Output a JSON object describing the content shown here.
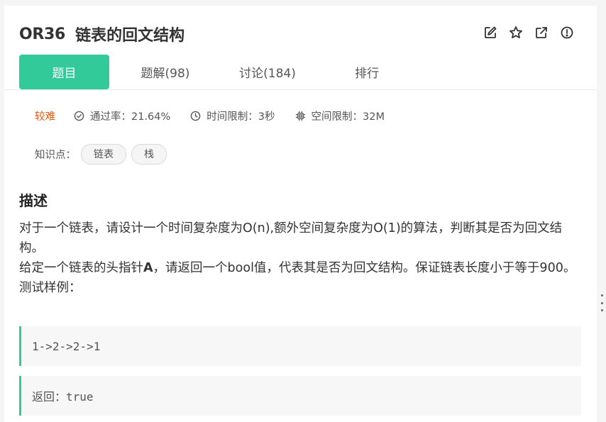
{
  "problem": {
    "id": "OR36",
    "title": "链表的回文结构"
  },
  "toolbar": {
    "icons": [
      "edit-icon",
      "star-icon",
      "share-icon",
      "report-icon"
    ]
  },
  "tabs": [
    {
      "label": "题目",
      "active": true
    },
    {
      "label": "题解(98)",
      "active": false
    },
    {
      "label": "讨论(184)",
      "active": false
    },
    {
      "label": "排行",
      "active": false
    }
  ],
  "meta": {
    "difficulty": "较难",
    "pass_rate": "通过率：21.64%",
    "time_limit": "时间限制：3秒",
    "space_limit": "空间限制：32M"
  },
  "knowledge": {
    "label": "知识点：",
    "tags": [
      "链表",
      "栈"
    ]
  },
  "description": {
    "heading": "描述",
    "line1": "对于一个链表，请设计一个时间复杂度为O(n),额外空间复杂度为O(1)的算法，判断其是否为回文结构。",
    "line2_pre": "给定一个链表的头指针",
    "line2_bold": "A",
    "line2_post": "，请返回一个bool值，代表其是否为回文结构。保证链表长度小于等于900。",
    "line3": "测试样例："
  },
  "samples": {
    "input": "1->2->2->1",
    "output": "返回：true"
  },
  "colors": {
    "accent": "#32ca99",
    "difficulty": "#e4580f"
  }
}
